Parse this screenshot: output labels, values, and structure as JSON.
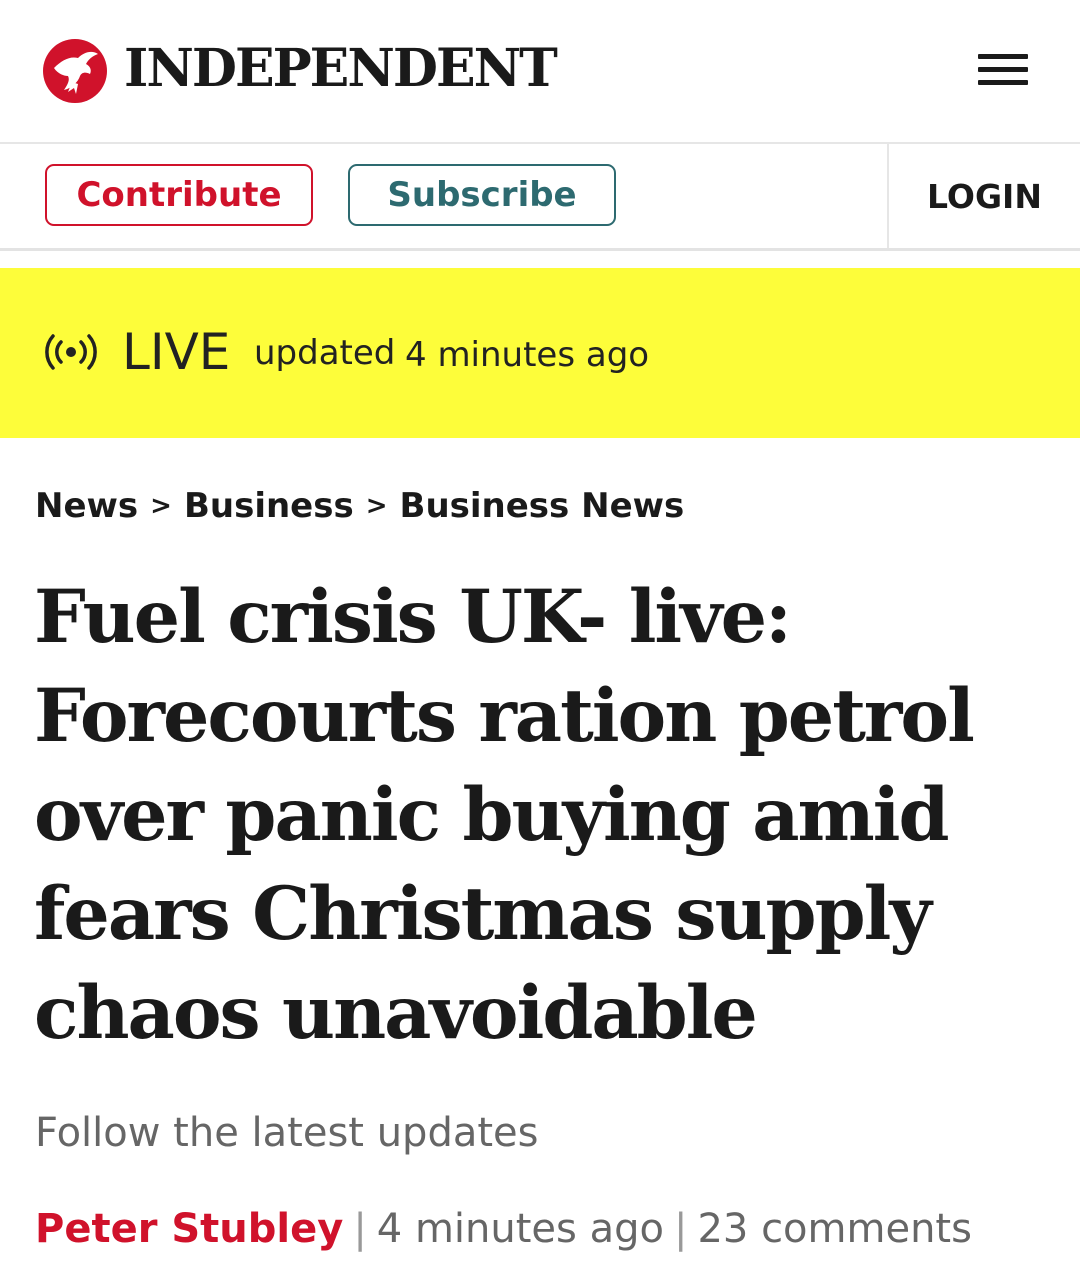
{
  "header": {
    "brand_name": "INDEPENDENT",
    "menu_icon": "hamburger-menu-icon",
    "brand_color": "#d0122b"
  },
  "actions": {
    "contribute_label": "Contribute",
    "subscribe_label": "Subscribe",
    "login_label": "LOGIN",
    "contribute_color": "#d0122b",
    "subscribe_color": "#2d6a70"
  },
  "live": {
    "icon": "broadcast-icon",
    "label": "LIVE",
    "updated_label": "updated",
    "updated_time": "4 minutes ago",
    "banner_color": "#fdfd3a"
  },
  "breadcrumb": {
    "items": [
      "News",
      "Business",
      "Business News"
    ],
    "separator": ">"
  },
  "article": {
    "headline_lines": [
      "Fuel crisis UK- live:",
      "Forecourts ration petrol",
      "over panic buying amid",
      "fears Christmas supply",
      "chaos unavoidable"
    ],
    "standfirst": "Follow the latest updates",
    "author": "Peter Stubley",
    "time": "4 minutes ago",
    "comments": "23 comments"
  }
}
